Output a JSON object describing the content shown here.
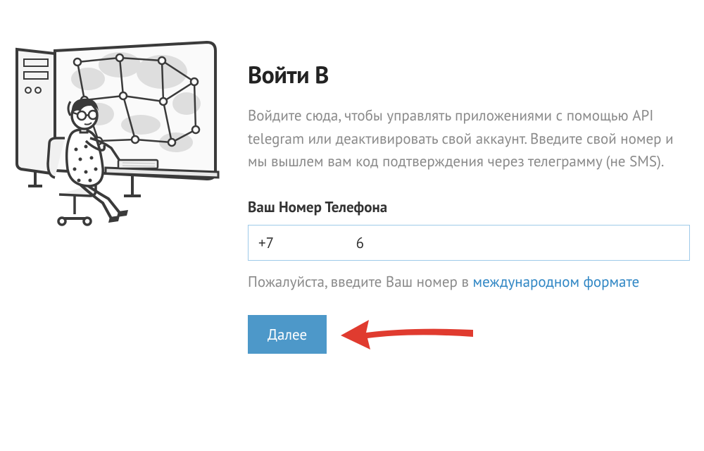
{
  "heading": "Войти В",
  "description": "Войдите сюда, чтобы управлять приложениями с помощью API telegram или деактивировать свой аккаунт. Введите свой номер и мы вышлем вам код подтверждения через телеграмму (не SMS).",
  "phone": {
    "label": "Ваш Номер Телефона",
    "value": "+7                     6"
  },
  "hint": {
    "prefix": "Пожалуйста, введите Ваш номер в ",
    "link_text": "международном формате"
  },
  "button": {
    "next": "Далее"
  },
  "colors": {
    "accent": "#4d98c9",
    "link": "#2f86c4",
    "input_border": "#9ecae9",
    "arrow": "#e03b2f"
  }
}
